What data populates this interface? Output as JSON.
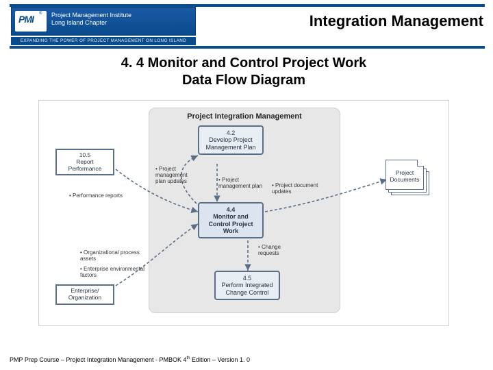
{
  "header": {
    "org_line1": "Project Management Institute",
    "org_line2": "Long Island Chapter",
    "tagline": "EXPANDING THE POWER OF PROJECT MANAGEMENT ON LONG ISLAND",
    "logo_pm": "PMI",
    "logo_reg": "®",
    "title": "Integration Management"
  },
  "slide": {
    "title_l1": "4. 4 Monitor and Control Project Work",
    "title_l2": "Data Flow Diagram"
  },
  "diagram": {
    "container_title": "Project Integration Management",
    "proc_42_num": "4.2",
    "proc_42_name": "Develop Project Management Plan",
    "proc_44_num": "4.4",
    "proc_44_name": "Monitor and Control Project Work",
    "proc_45_num": "4.5",
    "proc_45_name": "Perform Integrated Change Control",
    "side_105_num": "10.5",
    "side_105_name": "Report Performance",
    "side_ent": "Enterprise/ Organization",
    "doc_label": "Project Documents",
    "lbl_pm_plan_updates": "Project management plan updates",
    "lbl_pm_plan": "Project management plan",
    "lbl_perf_reports": "Performance reports",
    "lbl_opa": "Organizational process assets",
    "lbl_eef": "Enterprise environmental factors",
    "lbl_doc_updates": "Project document updates",
    "lbl_change_requests": "Change requests"
  },
  "footer": {
    "text_a": "PMP Prep Course – Project Integration Management - PMBOK 4",
    "th": "th",
    "text_b": " Edition – Version 1. 0"
  }
}
